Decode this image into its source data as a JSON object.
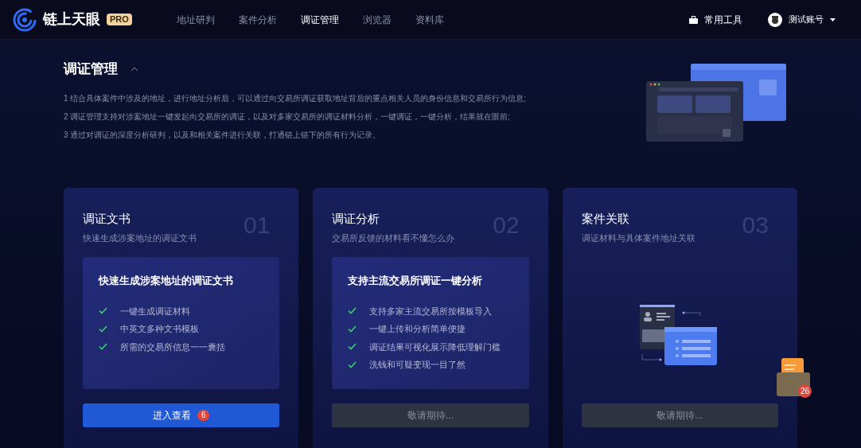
{
  "header": {
    "brand": "链上天眼",
    "badge": "PRO",
    "nav": [
      {
        "label": "地址研判",
        "selected": false
      },
      {
        "label": "案件分析",
        "selected": false
      },
      {
        "label": "调证管理",
        "selected": true
      },
      {
        "label": "浏览器",
        "selected": false
      },
      {
        "label": "资料库",
        "selected": false
      }
    ],
    "tools": "常用工具",
    "account": "测试账号"
  },
  "section": {
    "title": "调证管理",
    "expanded": true,
    "lines": [
      "1 结合具体案件中涉及的地址，进行地址分析后，可以通过向交易所调证获取地址背后的重点相关人员的身份信息和交易所行为信息;",
      "2 调证管理支持对涉案地址一键发起向交易所的调证，以及对多家交易所的调证材料分析，一键调证，一键分析，结果就在眼前;",
      "3 通过对调证的深度分析研判，以及和相关案件进行关联，打通链上链下的所有行为记录。"
    ]
  },
  "cards": [
    {
      "kind": "features",
      "title": "调证文书",
      "subtitle": "快速生成涉案地址的调证文书",
      "number": "01",
      "panel_title": "快速生成涉案地址的调证文书",
      "features": [
        "一键生成调证材料",
        "中英文多种文书模板",
        "所需的交易所信息一一囊括"
      ],
      "button": {
        "label": "进入查看",
        "disabled": false,
        "badge": "6"
      }
    },
    {
      "kind": "features",
      "title": "调证分析",
      "subtitle": "交易所反馈的材料看不懂怎么办",
      "number": "02",
      "panel_title": "支持主流交易所调证一键分析",
      "features": [
        "支持多家主流交易所按模板导入",
        "一键上传和分析简单便捷",
        "调证结果可视化展示降低理解门槛",
        "洗钱和可疑变现一目了然"
      ],
      "button": {
        "label": "敬请期待...",
        "disabled": true
      }
    },
    {
      "kind": "illustration",
      "title": "案件关联",
      "subtitle": "调证材料与具体案件地址关联",
      "number": "03",
      "button": {
        "label": "敬请期待...",
        "disabled": true
      }
    }
  ],
  "floating_widget": {
    "badge": "26"
  }
}
